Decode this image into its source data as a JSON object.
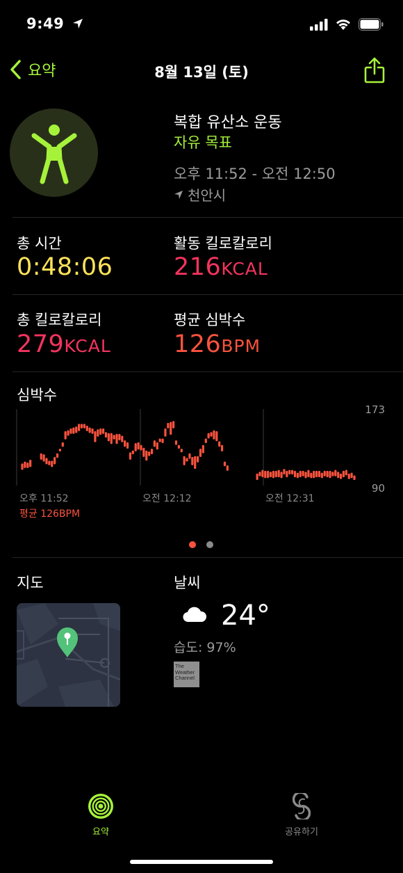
{
  "status": {
    "time": "9:49"
  },
  "nav": {
    "back_label": "요약",
    "title": "8월 13일 (토)"
  },
  "workout": {
    "name": "복합 유산소 운동",
    "goal": "자유 목표",
    "time_range": "오후 11:52 - 오전 12:50",
    "location": "천안시"
  },
  "stats": {
    "total_time_label": "총 시간",
    "total_time_value": "0:48:06",
    "active_kcal_label": "활동 킬로칼로리",
    "active_kcal_value": "216",
    "active_kcal_unit": "KCAL",
    "total_kcal_label": "총 킬로칼로리",
    "total_kcal_value": "279",
    "total_kcal_unit": "KCAL",
    "avg_hr_label": "평균 심박수",
    "avg_hr_value": "126",
    "avg_hr_unit": "BPM"
  },
  "heart_rate": {
    "title": "심박수",
    "avg_label": "평균 126BPM"
  },
  "chart_data": {
    "type": "bar",
    "title": "심박수",
    "ylim": [
      90,
      173
    ],
    "y_ticks": [
      "173",
      "90"
    ],
    "x_ticks": [
      "오후 11:52",
      "오전 12:12",
      "오전 12:31"
    ],
    "x": [
      0,
      1,
      2,
      3,
      4,
      5,
      6,
      7,
      8,
      9,
      10,
      11,
      12,
      13,
      14,
      15,
      16,
      17,
      18,
      19,
      20,
      21,
      22,
      23,
      24,
      25,
      26,
      27,
      28,
      29,
      30,
      31,
      32,
      33,
      34,
      35,
      36,
      37,
      38,
      39,
      40,
      41,
      42,
      43,
      44,
      45,
      46,
      47,
      48,
      49,
      50,
      51,
      52,
      53,
      54,
      55,
      56,
      57,
      58,
      59,
      60,
      61,
      62,
      63,
      64,
      65,
      66,
      67,
      68,
      69,
      70,
      71,
      72,
      73,
      74,
      75,
      76,
      77,
      78,
      79,
      80,
      81,
      82,
      83,
      84,
      85,
      86,
      87,
      88,
      89,
      90,
      91,
      92,
      93,
      94,
      95,
      96,
      97,
      98,
      99,
      100,
      101,
      102,
      103,
      104,
      105,
      106,
      107,
      108,
      109,
      110,
      111,
      112,
      113,
      114,
      115,
      116,
      117,
      118,
      119,
      120,
      121,
      122,
      123
    ],
    "series": [
      {
        "values_low": [
          107,
          109,
          109,
          110,
          null,
          null,
          null,
          118,
          116,
          113,
          112,
          110,
          113,
          120,
          127,
          132,
          140,
          144,
          146,
          146,
          147,
          149,
          152,
          152,
          149,
          147,
          146,
          137,
          143,
          145,
          146,
          142,
          138,
          135,
          140,
          135,
          139,
          137,
          132,
          130,
          118,
          124,
          127,
          129,
          128,
          121,
          117,
          122,
          124,
          132,
          129,
          137,
          136,
          143,
          152,
          145,
          152,
          134,
          130,
          126,
          112,
          116,
          119,
          112,
          108,
          115,
          121,
          125,
          136,
          141,
          143,
          140,
          138,
          132,
          127,
          111,
          106,
          null,
          null,
          null,
          null,
          null,
          null,
          null,
          null,
          null,
          null,
          96,
          100,
          99,
          98,
          98,
          99,
          98,
          99,
          99,
          98,
          102,
          99,
          102,
          102,
          99,
          98,
          99,
          100,
          98,
          99,
          98,
          98,
          99,
          99,
          98,
          100,
          99,
          98,
          100,
          100,
          98,
          97,
          99,
          101,
          97,
          98,
          96
        ],
        "values_high": [
          114,
          116,
          115,
          118,
          null,
          null,
          null,
          125,
          124,
          120,
          117,
          117,
          121,
          125,
          130,
          137,
          149,
          150,
          152,
          153,
          154,
          157,
          157,
          157,
          155,
          153,
          152,
          149,
          151,
          152,
          152,
          148,
          147,
          147,
          145,
          146,
          146,
          144,
          139,
          137,
          126,
          128,
          136,
          137,
          134,
          131,
          128,
          127,
          130,
          139,
          137,
          141,
          141,
          152,
          158,
          159,
          160,
          139,
          134,
          130,
          122,
          120,
          125,
          121,
          122,
          122,
          130,
          134,
          141,
          147,
          148,
          150,
          149,
          138,
          134,
          116,
          112,
          null,
          null,
          null,
          null,
          null,
          null,
          null,
          null,
          null,
          null,
          103,
          105,
          107,
          106,
          106,
          105,
          106,
          106,
          107,
          105,
          108,
          106,
          107,
          107,
          106,
          104,
          106,
          106,
          105,
          107,
          104,
          106,
          106,
          106,
          104,
          106,
          106,
          106,
          105,
          107,
          105,
          103,
          106,
          107,
          103,
          104,
          101
        ]
      }
    ]
  },
  "pager": {
    "count": 2,
    "active": 0
  },
  "map": {
    "label": "지도"
  },
  "weather": {
    "label": "날씨",
    "temp": "24°",
    "humidity": "습도: 97%",
    "brand_lines": [
      "The",
      "Weather",
      "Channel"
    ]
  },
  "tabs": [
    {
      "label": "요약",
      "icon": "activity-rings-icon",
      "active": true
    },
    {
      "label": "공유하기",
      "icon": "sharing-icon",
      "active": false
    }
  ],
  "colors": {
    "accent": "#a6f23b",
    "yellow": "#ffe35a",
    "red": "#f4345e",
    "orange": "#f9533e"
  }
}
